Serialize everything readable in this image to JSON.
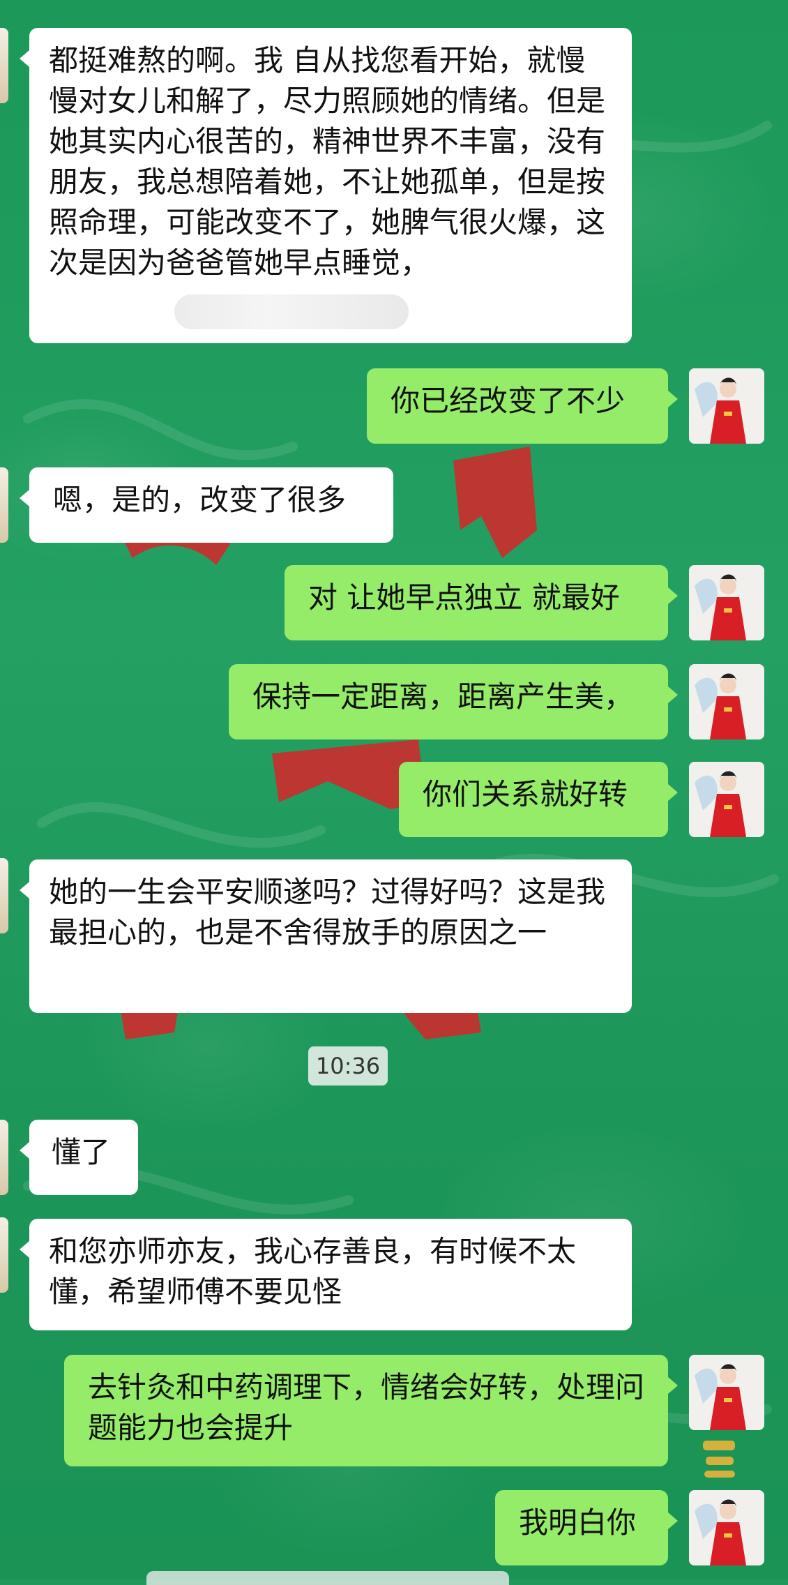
{
  "chat": {
    "timestamp": "10:36",
    "messages": [
      {
        "side": "in",
        "text": "都挺难熬的啊。我 自从找您看开始，就慢慢对女儿和解了，尽力照顾她的情绪。但是她其实内心很苦的，精神世界不丰富，没有朋友，我总想陪着她，不让她孤单，但是按照命理，可能改变不了，她脾气很火爆，这次是因为爸爸管她早点睡觉，"
      },
      {
        "side": "out",
        "text": "你已经改变了不少"
      },
      {
        "side": "in",
        "text": "嗯，是的，改变了很多"
      },
      {
        "side": "out",
        "text": "对 让她早点独立 就最好"
      },
      {
        "side": "out",
        "text": "保持一定距离，距离产生美，"
      },
      {
        "side": "out",
        "text": "你们关系就好转"
      },
      {
        "side": "in",
        "text": "她的一生会平安顺遂吗？过得好吗？这是我最担心的，也是不舍得放手的原因之一"
      },
      {
        "side": "in",
        "text": "懂了"
      },
      {
        "side": "in",
        "text": "和您亦师亦友，我心存善良，有时候不太懂，希望师傅不要见怪"
      },
      {
        "side": "out",
        "text": "去针灸和中药调理下，情绪会好转，处理问题能力也会提升"
      },
      {
        "side": "out",
        "text": "我明白你"
      }
    ]
  },
  "colors": {
    "background": "#1f9a5c",
    "bubble_in": "#ffffff",
    "bubble_out": "#95ec69"
  },
  "icons": {
    "avatar": "user-avatar-red-robe-figure"
  }
}
